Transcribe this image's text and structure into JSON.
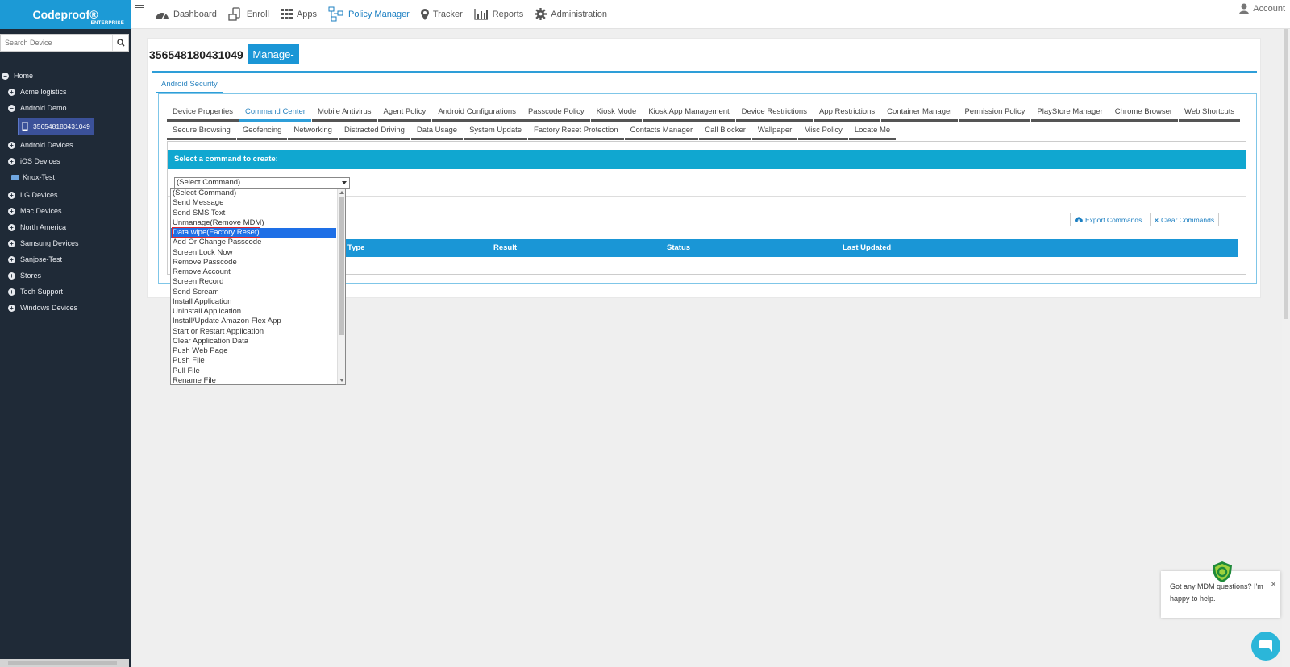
{
  "brand": {
    "name": "Codeproof®",
    "edition": "ENTERPRISE"
  },
  "search": {
    "placeholder": "Search Device"
  },
  "tree": {
    "home": "Home",
    "groups": [
      {
        "label": "Acme logistics",
        "toggle": "+"
      },
      {
        "label": "Android Demo",
        "toggle": "−"
      }
    ],
    "device": "356548180431049",
    "groups2": [
      {
        "label": "Android Devices",
        "toggle": "+"
      },
      {
        "label": "iOS Devices",
        "toggle": "+"
      }
    ],
    "knox": "Knox-Test",
    "groups3": [
      {
        "label": "LG Devices",
        "toggle": "+"
      },
      {
        "label": "Mac Devices",
        "toggle": "+"
      },
      {
        "label": "North America",
        "toggle": "+"
      },
      {
        "label": "Samsung Devices",
        "toggle": "+"
      },
      {
        "label": "Sanjose-Test",
        "toggle": "+"
      },
      {
        "label": "Stores",
        "toggle": "+"
      },
      {
        "label": "Tech Support",
        "toggle": "+"
      },
      {
        "label": "Windows Devices",
        "toggle": "+"
      }
    ]
  },
  "nav": {
    "items": [
      {
        "label": "Dashboard",
        "icon": "dashboard-icon"
      },
      {
        "label": "Enroll",
        "icon": "enroll-icon"
      },
      {
        "label": "Apps",
        "icon": "apps-grid-icon"
      },
      {
        "label": "Policy Manager",
        "icon": "policy-manager-icon",
        "active": true
      },
      {
        "label": "Tracker",
        "icon": "map-pin-icon"
      },
      {
        "label": "Reports",
        "icon": "bar-chart-icon"
      },
      {
        "label": "Administration",
        "icon": "gear-icon"
      }
    ],
    "account": "Account"
  },
  "page": {
    "device_id": "356548180431049",
    "manage_label": "Manage-",
    "section_tab": "Android Security"
  },
  "tabs_row1": [
    "Device Properties",
    "Command Center",
    "Mobile Antivirus",
    "Agent Policy",
    "Android Configurations",
    "Passcode Policy",
    "Kiosk Mode",
    "Kiosk App Management",
    "Device Restrictions",
    "App Restrictions",
    "Container Manager",
    "Permission Policy",
    "PlayStore Manager",
    "Chrome Browser",
    "Web Shortcuts"
  ],
  "tabs_row2": [
    "Secure Browsing",
    "Geofencing",
    "Networking",
    "Distracted Driving",
    "Data Usage",
    "System Update",
    "Factory Reset Protection",
    "Contacts Manager",
    "Call Blocker",
    "Wallpaper",
    "Misc Policy",
    "Locate Me"
  ],
  "active_tab": "Command Center",
  "command": {
    "header": "Select a command to create:",
    "selected": "(Select Command)",
    "export_label": "Export Commands",
    "clear_label": "Clear Commands",
    "columns": [
      "Type",
      "Result",
      "Status",
      "Last Updated"
    ],
    "options": [
      "(Select Command)",
      "Send Message",
      "Send SMS Text",
      "Unmanage(Remove MDM)",
      "Data wipe(Factory Reset)",
      "Add Or Change Passcode",
      "Screen Lock Now",
      "Remove Passcode",
      "Remove Account",
      "Screen Record",
      "Send Scream",
      "Install Application",
      "Uninstall Application",
      "Install/Update Amazon Flex App",
      "Start or Restart Application",
      "Clear Application Data",
      "Push Web Page",
      "Push File",
      "Pull File",
      "Rename File"
    ],
    "highlighted_option": "Data wipe(Factory Reset)"
  },
  "chat": {
    "message_line1": "Got any MDM questions? I'm",
    "message_line2": "happy to help."
  },
  "colors": {
    "brand": "#1c9ad6",
    "sidebar": "#1f2a37",
    "header_bar": "#10a7d0",
    "accent": "#2e9ed8"
  }
}
